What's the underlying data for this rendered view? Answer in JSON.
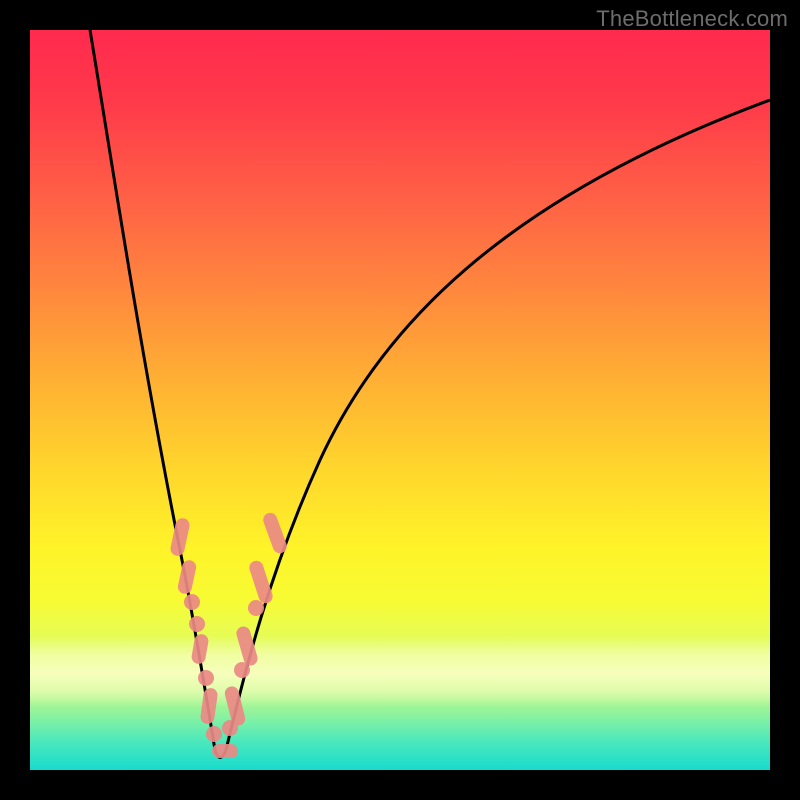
{
  "watermark": "TheBottleneck.com",
  "chart_data": {
    "type": "line",
    "title": "",
    "xlabel": "",
    "ylabel": "",
    "xlim": [
      0,
      100
    ],
    "ylim": [
      0,
      100
    ],
    "grid": false,
    "series": [
      {
        "name": "curve",
        "x": [
          8,
          10,
          12,
          14,
          16,
          18,
          20,
          22,
          24,
          25,
          26,
          28,
          30,
          34,
          40,
          48,
          58,
          70,
          84,
          100
        ],
        "y": [
          100,
          88,
          76,
          64,
          52,
          40,
          28,
          16,
          6,
          0,
          4,
          12,
          20,
          32,
          45,
          57,
          68,
          78,
          86,
          92
        ]
      },
      {
        "name": "scatter-cluster",
        "x": [
          20,
          20.8,
          21.6,
          22.4,
          23.2,
          24,
          24.8,
          25.6,
          26.4,
          27.2,
          28,
          28.8,
          29.6,
          30.4,
          31.2,
          32,
          33
        ],
        "y": [
          30,
          25,
          20,
          15,
          10,
          6,
          3,
          1,
          3,
          6,
          10,
          14,
          18,
          22,
          26,
          30,
          34
        ]
      }
    ],
    "colors": {
      "curve": "#000000",
      "scatter": "#e57373",
      "gradient_top": "#ff2a4e",
      "gradient_bottom": "#18dbcd"
    }
  }
}
